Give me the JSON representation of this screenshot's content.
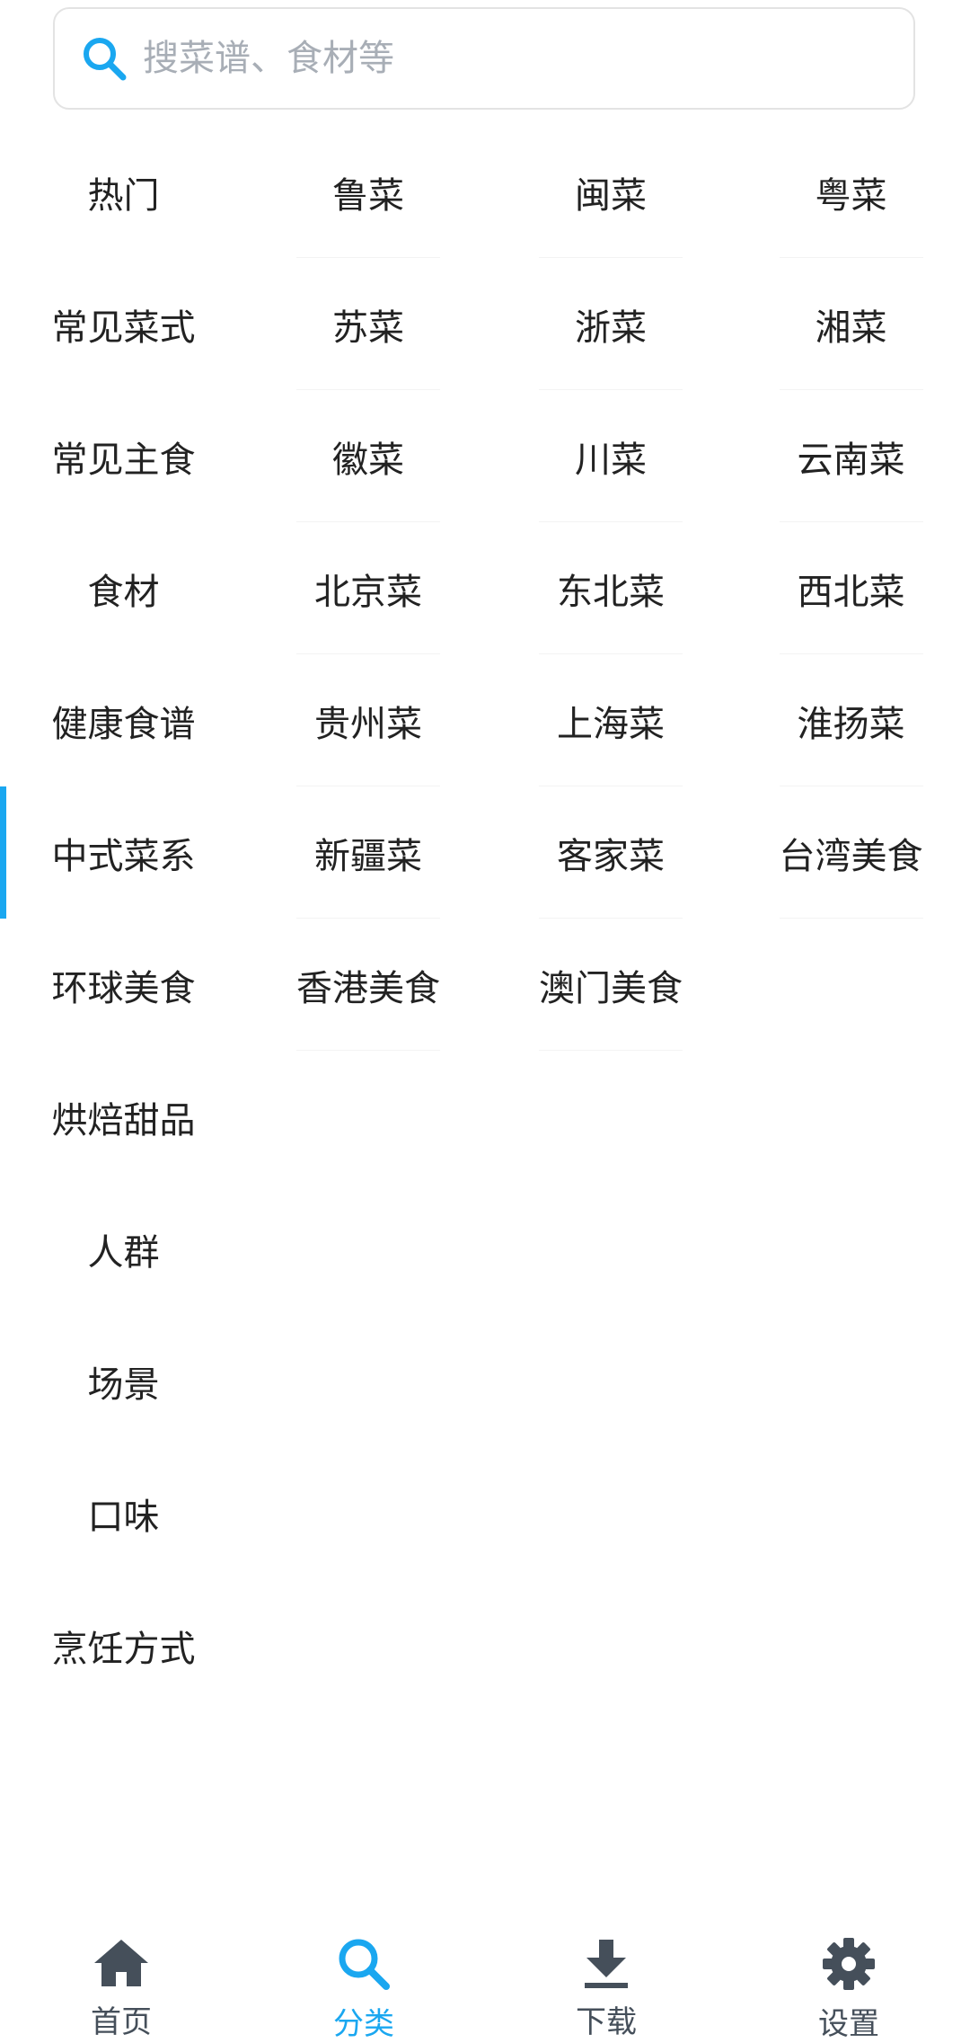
{
  "search": {
    "placeholder": "搜菜谱、食材等"
  },
  "categories": [
    "热门",
    "常见菜式",
    "常见主食",
    "食材",
    "健康食谱",
    "中式菜系",
    "环球美食",
    "烘焙甜品",
    "人群",
    "场景",
    "口味",
    "烹饪方式"
  ],
  "active_category": "中式菜系",
  "subcategories": [
    "鲁菜",
    "闽菜",
    "粤菜",
    "苏菜",
    "浙菜",
    "湘菜",
    "徽菜",
    "川菜",
    "云南菜",
    "北京菜",
    "东北菜",
    "西北菜",
    "贵州菜",
    "上海菜",
    "淮扬菜",
    "新疆菜",
    "客家菜",
    "台湾美食",
    "香港美食",
    "澳门美食"
  ],
  "tabs": [
    {
      "label": "首页",
      "icon": "home-icon"
    },
    {
      "label": "分类",
      "icon": "search-icon"
    },
    {
      "label": "下载",
      "icon": "download-icon"
    },
    {
      "label": "设置",
      "icon": "gear-icon"
    }
  ],
  "colors": {
    "accent": "#1aa7f0",
    "tab_inactive": "#454f5a",
    "text": "#222222",
    "placeholder": "#a8aeb6"
  }
}
